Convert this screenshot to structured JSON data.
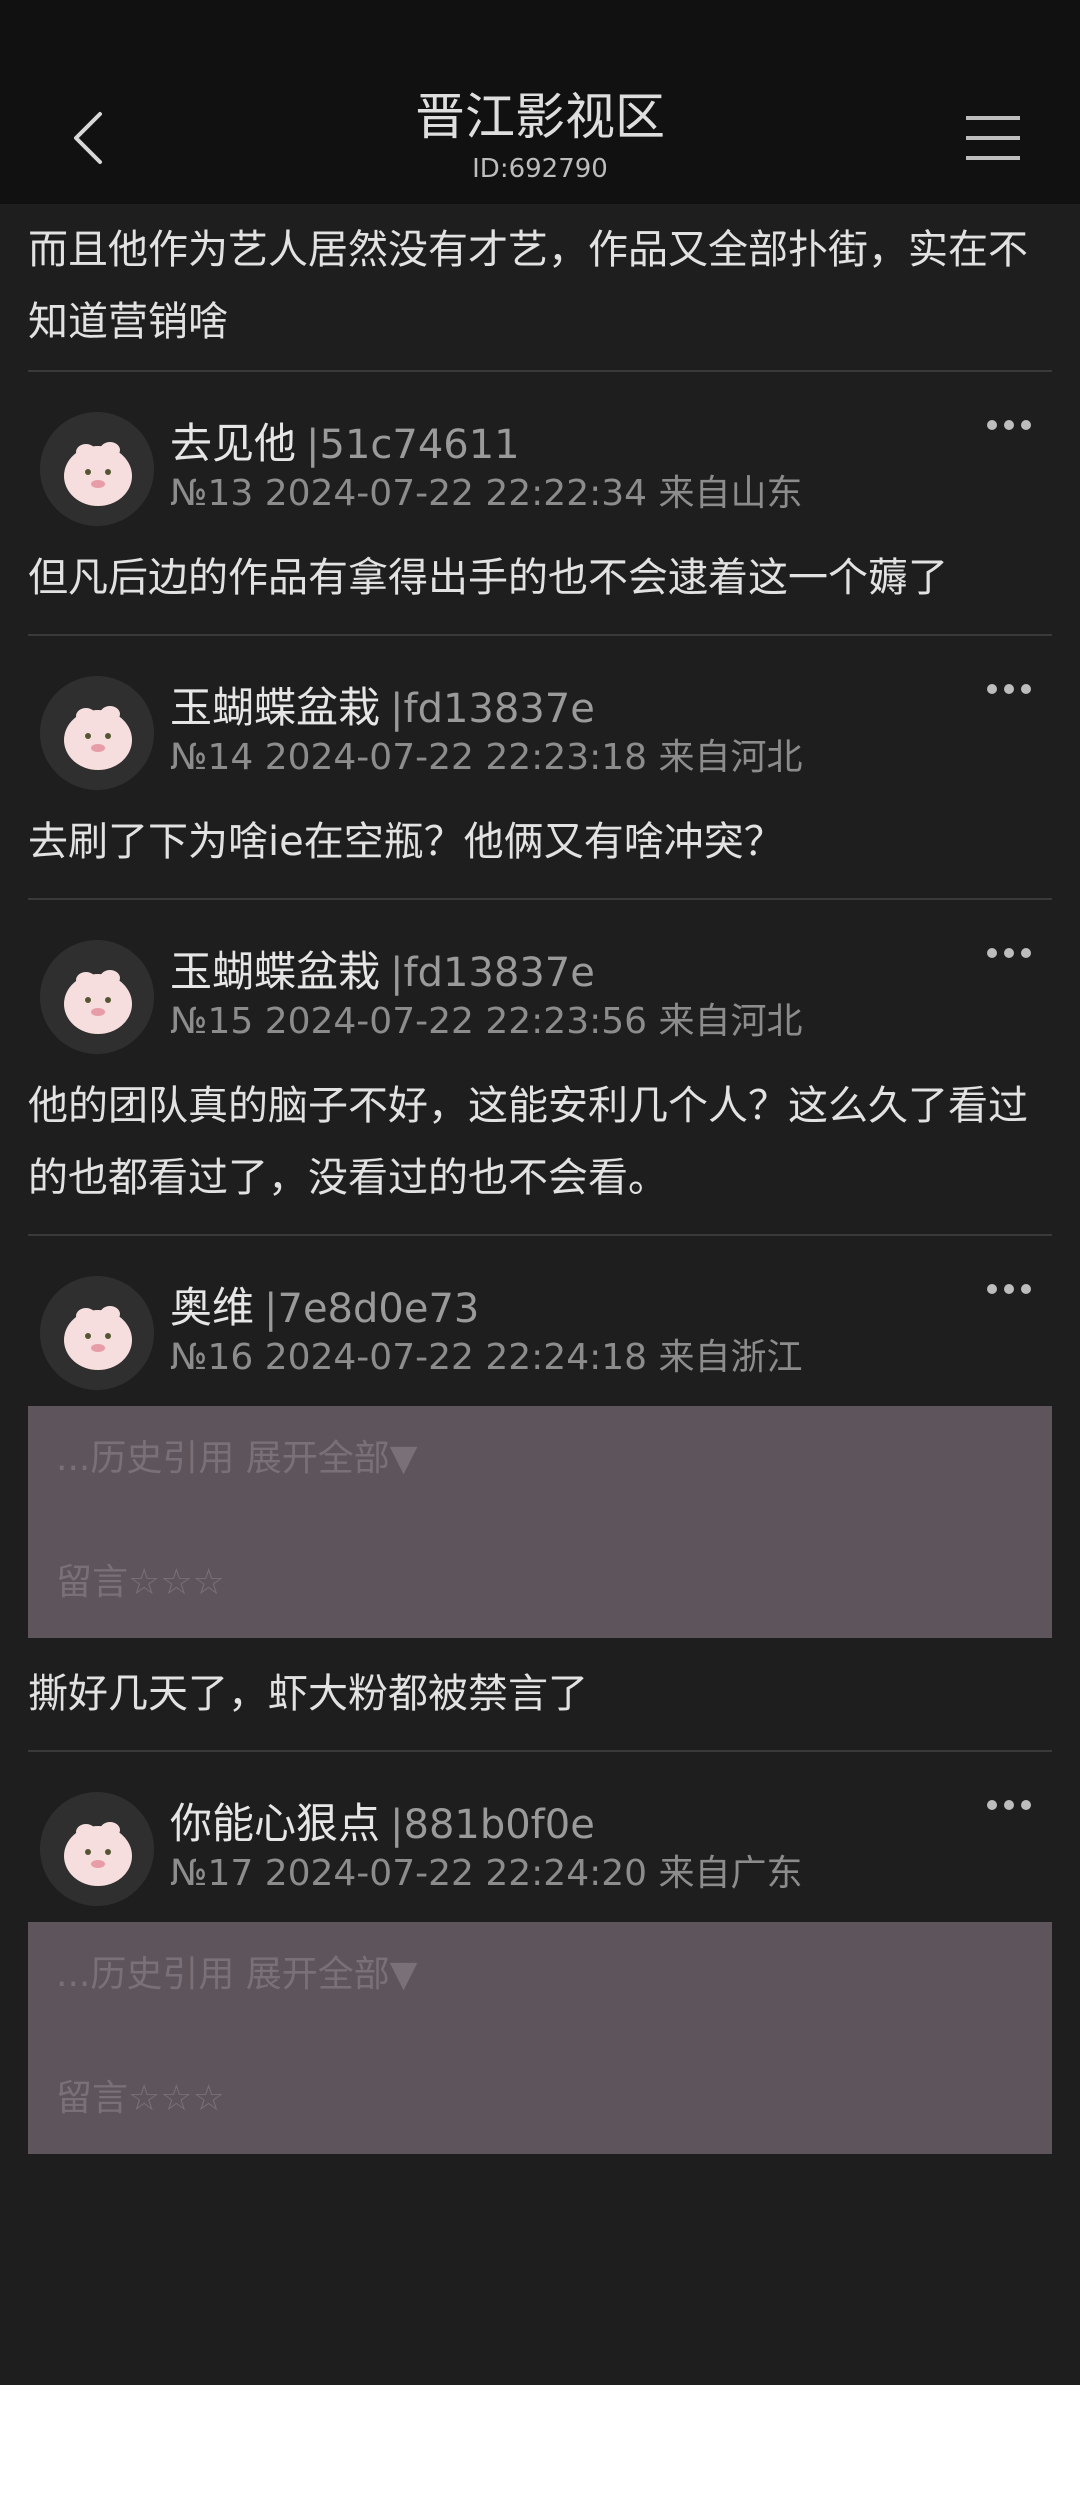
{
  "header": {
    "title": "晋江影视区",
    "subtitle": "ID:692790"
  },
  "continuation_text": "而且他作为艺人居然没有才艺，作品又全部扑街，实在不知道营销啥",
  "posts": [
    {
      "name": "去见他",
      "uid": "|51c74611",
      "meta": "№13 2024-07-22 22:22:34 来自山东",
      "text": "但凡后边的作品有拿得出手的也不会逮着这一个薅了"
    },
    {
      "name": "玉蝴蝶盆栽",
      "uid": "|fd13837e",
      "meta": "№14 2024-07-22 22:23:18 来自河北",
      "text": "去刷了下为啥ie在空瓶？他俩又有啥冲突？"
    },
    {
      "name": "玉蝴蝶盆栽",
      "uid": "|fd13837e",
      "meta": "№15 2024-07-22 22:23:56 来自河北",
      "text": "他的团队真的脑子不好，这能安利几个人？这么久了看过的也都看过了，没看过的也不会看。"
    },
    {
      "name": "奥维",
      "uid": "|7e8d0e73",
      "meta": "№16 2024-07-22 22:24:18 来自浙江",
      "quote_expand": "...历史引用 展开全部▼",
      "quote_text": "留言☆☆☆",
      "text": "撕好几天了，虾大粉都被禁言了"
    },
    {
      "name": "你能心狠点",
      "uid": "|881b0f0e",
      "meta": "№17 2024-07-22 22:24:20 来自广东",
      "quote_expand": "...历史引用 展开全部▼",
      "quote_text": "留言☆☆☆"
    }
  ],
  "colors": {
    "background": "#1e1e1e",
    "header": "#111111",
    "quote_box": "#5e555c",
    "text": "#e2e2e2",
    "meta": "#8c8c8c"
  },
  "icons": [
    "back-arrow-icon",
    "hamburger-menu-icon",
    "more-dots-icon",
    "avatar-pig-icon"
  ]
}
